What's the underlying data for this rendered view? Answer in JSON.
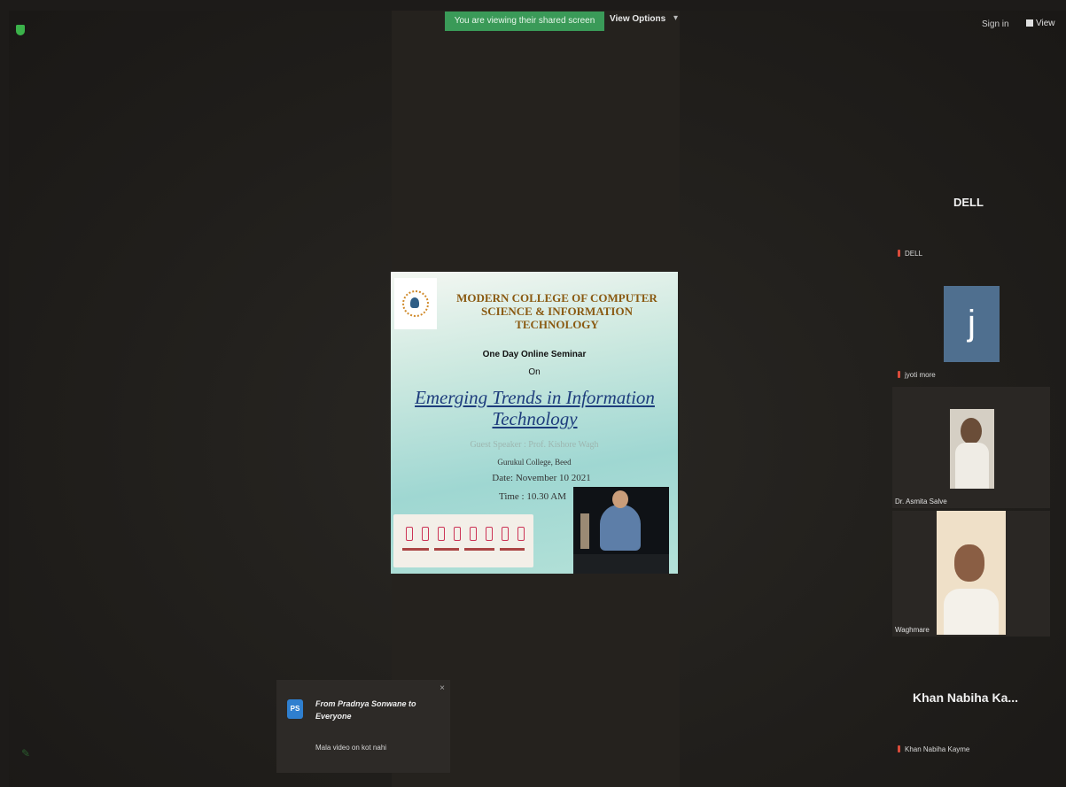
{
  "top_bar": {
    "banner": "You are viewing their shared screen",
    "view_options": "View Options",
    "view_options_caret": "▾",
    "sign_in": "Sign in",
    "view": "View"
  },
  "slide": {
    "college": "MODERN COLLEGE OF COMPUTER SCIENCE & INFORMATION TECHNOLOGY",
    "line1": "One Day Online Seminar",
    "line2": "On",
    "topic": "Emerging Trends in Information Technology",
    "speaker": "Guest Speaker : Prof. Kishore Wagh",
    "affiliation": "Gurukul College, Beed",
    "date": "Date: November 10 2021",
    "time": "Time : 10.30 AM"
  },
  "participants": {
    "dell_name": "DELL",
    "dell_label": "DELL",
    "j_initial": "j",
    "j_label": "jyoti more",
    "tile3_label": "Dr. Asmita Salve",
    "tile4_label": "Waghmare",
    "khan_name": "Khan Nabiha Ka...",
    "khan_label": "Khan Nabiha Kayme"
  },
  "chat": {
    "avatar": "PS",
    "from": "From Pradnya Sonwane to Everyone",
    "message": "Mala video on kot nahi",
    "close": "×"
  },
  "colors": {
    "banner_green": "#3a9a58",
    "mic_muted": "#d94b3a",
    "avatar_blue": "#4f6f8f"
  }
}
